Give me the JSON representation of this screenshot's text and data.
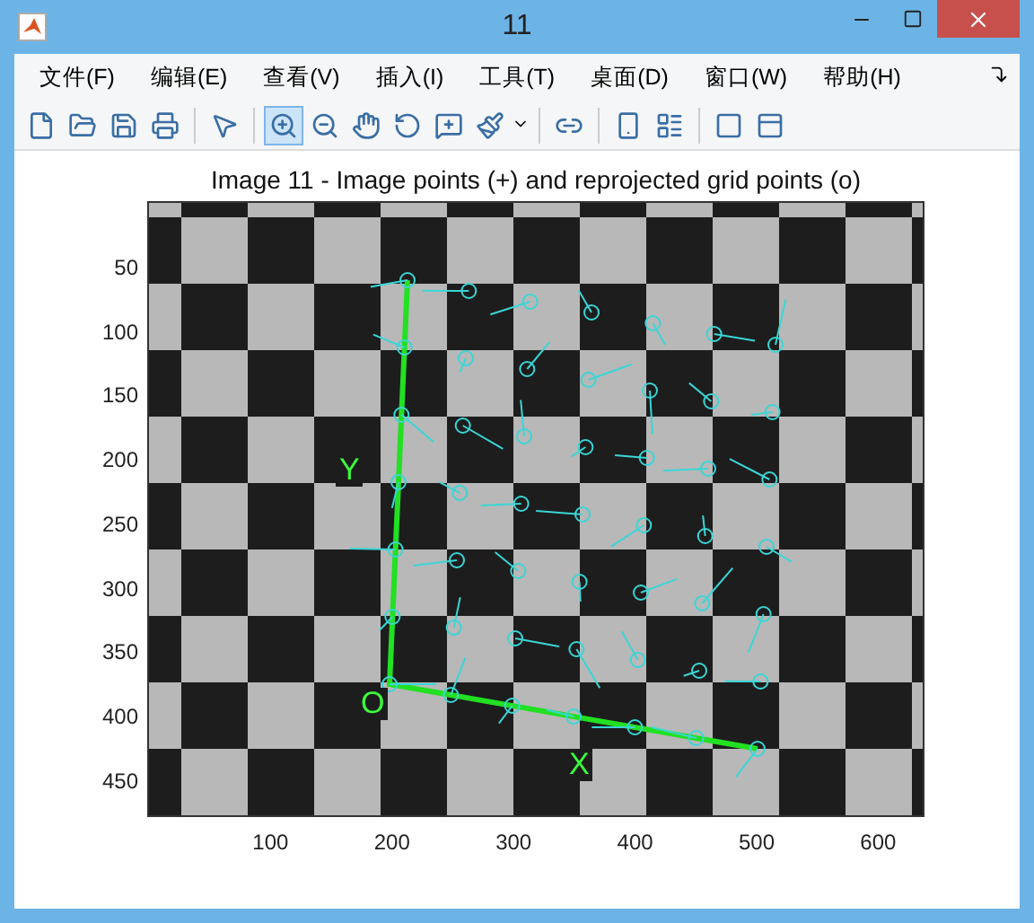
{
  "window": {
    "title": "11"
  },
  "menu": [
    "文件(F)",
    "编辑(E)",
    "查看(V)",
    "插入(I)",
    "工具(T)",
    "桌面(D)",
    "窗口(W)",
    "帮助(H)"
  ],
  "toolbar": [
    {
      "kind": "tool",
      "selected": false
    },
    {
      "kind": "tool",
      "selected": false
    },
    {
      "kind": "tool",
      "selected": false
    },
    {
      "kind": "tool",
      "selected": false
    },
    {
      "kind": "separator"
    },
    {
      "kind": "tool",
      "selected": false
    },
    {
      "kind": "separator"
    },
    {
      "kind": "tool",
      "selected": true
    },
    {
      "kind": "tool",
      "selected": false
    },
    {
      "kind": "tool",
      "selected": false
    },
    {
      "kind": "tool",
      "selected": false
    },
    {
      "kind": "tool",
      "selected": false
    },
    {
      "kind": "tool",
      "selected": false
    },
    {
      "kind": "separator"
    },
    {
      "kind": "tool",
      "selected": false
    },
    {
      "kind": "separator"
    },
    {
      "kind": "tool",
      "selected": false
    },
    {
      "kind": "tool",
      "selected": false
    },
    {
      "kind": "separator"
    },
    {
      "kind": "tool",
      "selected": false
    },
    {
      "kind": "tool",
      "selected": false
    }
  ],
  "plot": {
    "title": "Image 11 - Image points (+) and reprojected grid points (o)",
    "yticks": [
      "50",
      "100",
      "150",
      "200",
      "250",
      "300",
      "350",
      "400",
      "450"
    ],
    "xticks": [
      "100",
      "200",
      "300",
      "400",
      "500",
      "600"
    ],
    "axis_labels": [
      {
        "kind": "y",
        "text": "Y"
      },
      {
        "kind": "origin",
        "text": "O"
      },
      {
        "kind": "x",
        "text": "X"
      }
    ]
  }
}
